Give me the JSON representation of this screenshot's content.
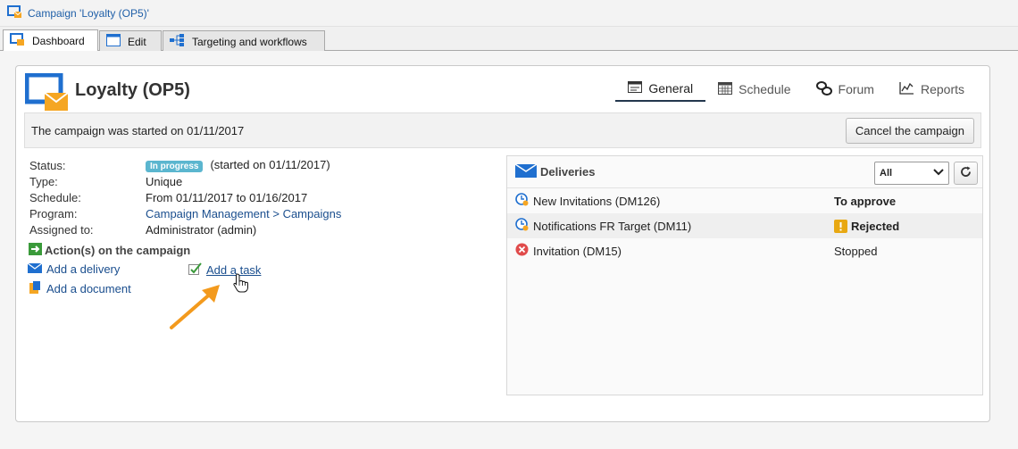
{
  "window": {
    "title": "Campaign 'Loyalty (OP5)'"
  },
  "tabs": [
    {
      "label": "Dashboard",
      "icon": "dashboard-icon",
      "active": true
    },
    {
      "label": "Edit",
      "icon": "edit-window-icon",
      "active": false
    },
    {
      "label": "Targeting and workflows",
      "icon": "workflow-icon",
      "active": false
    }
  ],
  "campaign": {
    "title": "Loyalty (OP5)",
    "started_message": "The campaign was started on 01/11/2017",
    "cancel_label": "Cancel the campaign"
  },
  "subtabs": [
    {
      "label": "General",
      "icon": "general-icon",
      "active": true
    },
    {
      "label": "Schedule",
      "icon": "calendar-icon",
      "active": false
    },
    {
      "label": "Forum",
      "icon": "forum-icon",
      "active": false
    },
    {
      "label": "Reports",
      "icon": "reports-icon",
      "active": false
    }
  ],
  "info": {
    "status_label": "Status:",
    "status_badge": "In progress",
    "status_detail": "(started on 01/11/2017)",
    "type_label": "Type:",
    "type_value": "Unique",
    "schedule_label": "Schedule:",
    "schedule_value": "From 01/11/2017 to 01/16/2017",
    "program_label": "Program:",
    "program_value": "Campaign Management > Campaigns",
    "assigned_label": "Assigned to:",
    "assigned_value": "Administrator (admin)"
  },
  "actions": {
    "title": "Action(s) on the campaign",
    "add_delivery": "Add a delivery",
    "add_task": "Add a task",
    "add_document": "Add a document"
  },
  "deliveries": {
    "title": "Deliveries",
    "filter_value": "All",
    "items": [
      {
        "name": "New Invitations (DM126)",
        "status": "To approve",
        "icon": "delivery-pending-icon"
      },
      {
        "name": "Notifications FR Target (DM11)",
        "status": "Rejected",
        "icon": "delivery-pending-icon"
      },
      {
        "name": "Invitation (DM15)",
        "status": "Stopped",
        "icon": "stopped-icon"
      }
    ]
  },
  "colors": {
    "link": "#1a4e8e",
    "badge": "#5bb6cf",
    "warning": "#e8a812",
    "error": "#e04b4b",
    "arrow": "#f39a1d",
    "brand": "#1f6fcf",
    "envelope": "#f5a623"
  }
}
